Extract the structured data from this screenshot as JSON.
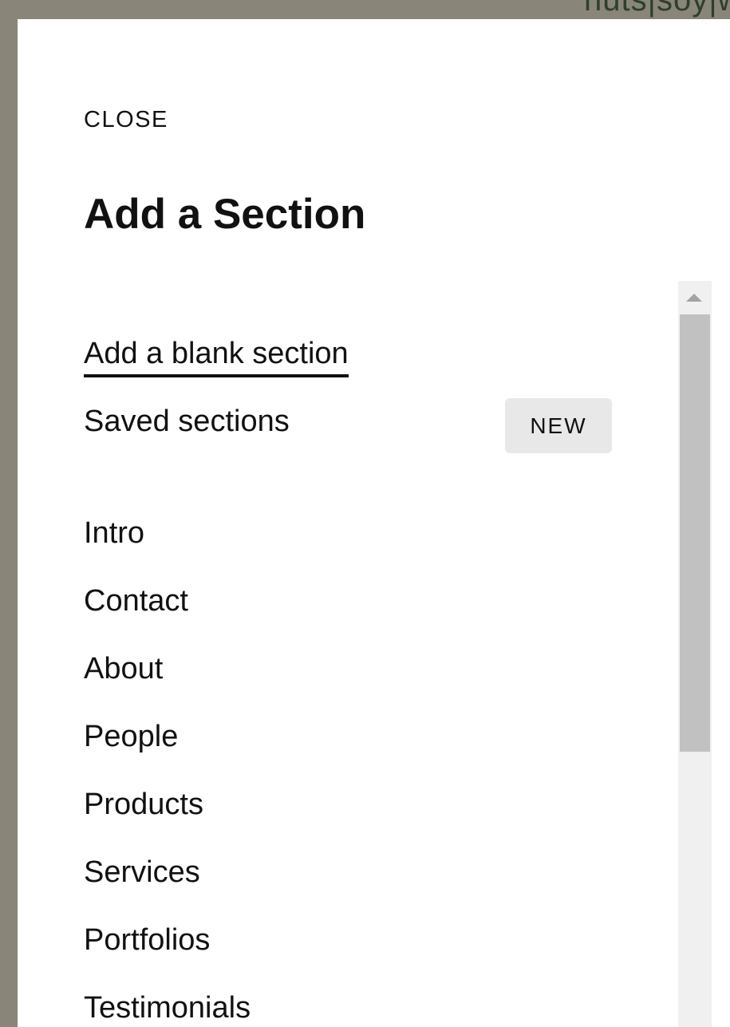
{
  "background_text": "nuts|soy|w",
  "panel": {
    "close_label": "CLOSE",
    "title": "Add a Section",
    "tabs": [
      {
        "label": "Add a blank section",
        "active": true
      },
      {
        "label": "Saved sections",
        "badge": "NEW"
      }
    ],
    "categories": [
      "Intro",
      "Contact",
      "About",
      "People",
      "Products",
      "Services",
      "Portfolios",
      "Testimonials"
    ]
  }
}
